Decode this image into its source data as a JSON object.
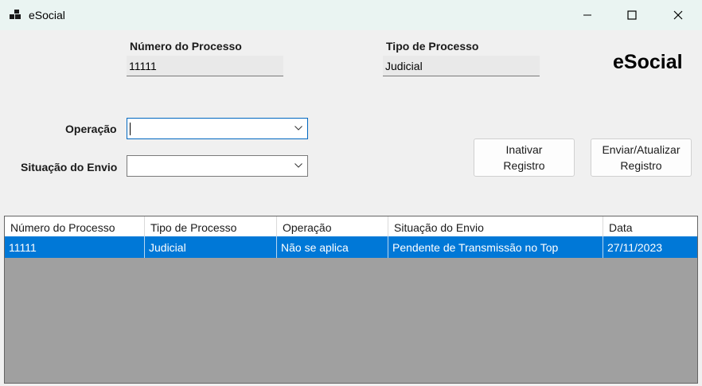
{
  "window": {
    "title": "eSocial",
    "icon": "app-icon",
    "controls": [
      "minimize-icon",
      "maximize-icon",
      "close-icon"
    ]
  },
  "header": {
    "processo_label": "Número do Processo",
    "processo_value": "11111",
    "tipo_label": "Tipo de Processo",
    "tipo_value": "Judicial",
    "brand": "eSocial"
  },
  "form": {
    "operacao_label": "Operação",
    "operacao_value": "",
    "situacao_label": "Situação do Envio",
    "situacao_value": ""
  },
  "buttons": {
    "inativar": "Inativar\nRegistro",
    "enviar": "Enviar/Atualizar\nRegistro"
  },
  "grid": {
    "columns": [
      "Número do Processo",
      "Tipo de Processo",
      "Operação",
      "Situação do Envio",
      "Data"
    ],
    "rows": [
      [
        "11111",
        "Judicial",
        "Não se aplica",
        "Pendente de Transmissão no Top",
        "27/11/2023"
      ]
    ],
    "selected_row": 0,
    "selection_color": "#0078d7"
  }
}
